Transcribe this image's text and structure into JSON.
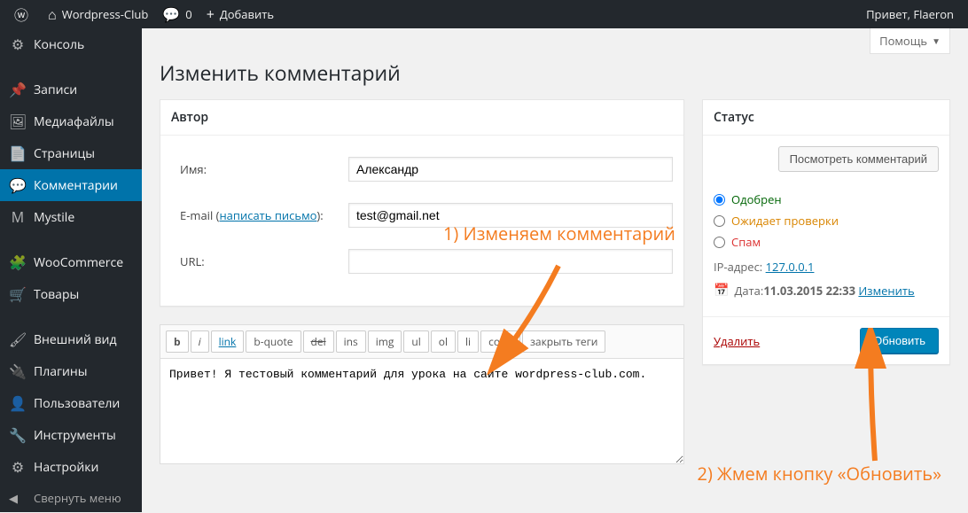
{
  "admin_bar": {
    "site_name": "Wordpress-Club",
    "comments_count": "0",
    "add_new": "Добавить",
    "greeting": "Привет, Flaeron"
  },
  "sidebar": {
    "items": [
      {
        "icon": "⚙",
        "label": "Консоль"
      },
      {
        "icon": "📌",
        "label": "Записи"
      },
      {
        "icon": "🖼",
        "label": "Медиафайлы"
      },
      {
        "icon": "📄",
        "label": "Страницы"
      },
      {
        "icon": "💬",
        "label": "Комментарии",
        "current": true
      },
      {
        "icon": "M",
        "label": "Mystile"
      },
      {
        "icon": "🧩",
        "label": "WooCommerce"
      },
      {
        "icon": "🛒",
        "label": "Товары"
      },
      {
        "icon": "🖌",
        "label": "Внешний вид"
      },
      {
        "icon": "🔌",
        "label": "Плагины"
      },
      {
        "icon": "👤",
        "label": "Пользователи"
      },
      {
        "icon": "🔧",
        "label": "Инструменты"
      },
      {
        "icon": "⚙",
        "label": "Настройки"
      }
    ],
    "collapse": "Свернуть меню"
  },
  "screen": {
    "help_tab": "Помощь",
    "page_title": "Изменить комментарий"
  },
  "author_box": {
    "heading": "Автор",
    "name_label": "Имя:",
    "name_value": "Александр",
    "email_label_prefix": "E-mail (",
    "email_link": "написать письмо",
    "email_label_suffix": "):",
    "email_value": "test@gmail.net",
    "url_label": "URL:",
    "url_value": ""
  },
  "editor": {
    "buttons": [
      "b",
      "i",
      "link",
      "b-quote",
      "del",
      "ins",
      "img",
      "ul",
      "ol",
      "li",
      "code",
      "закрыть теги"
    ],
    "content": "Привет! Я тестовый комментарий для урока на сайте wordpress-club.com."
  },
  "status_box": {
    "heading": "Статус",
    "view_btn": "Посмотреть комментарий",
    "approved": "Одобрен",
    "pending": "Ожидает проверки",
    "spam": "Спам",
    "ip_prefix": "IP-адрес: ",
    "ip_value": "127.0.0.1",
    "date_prefix": "Дата: ",
    "date_value": "11.03.2015 22:33",
    "date_edit": "Изменить",
    "delete": "Удалить",
    "update": "Обновить"
  },
  "annotations": {
    "a1": "1) Изменяем комментарий",
    "a2": "2) Жмем кнопку «Обновить»"
  }
}
